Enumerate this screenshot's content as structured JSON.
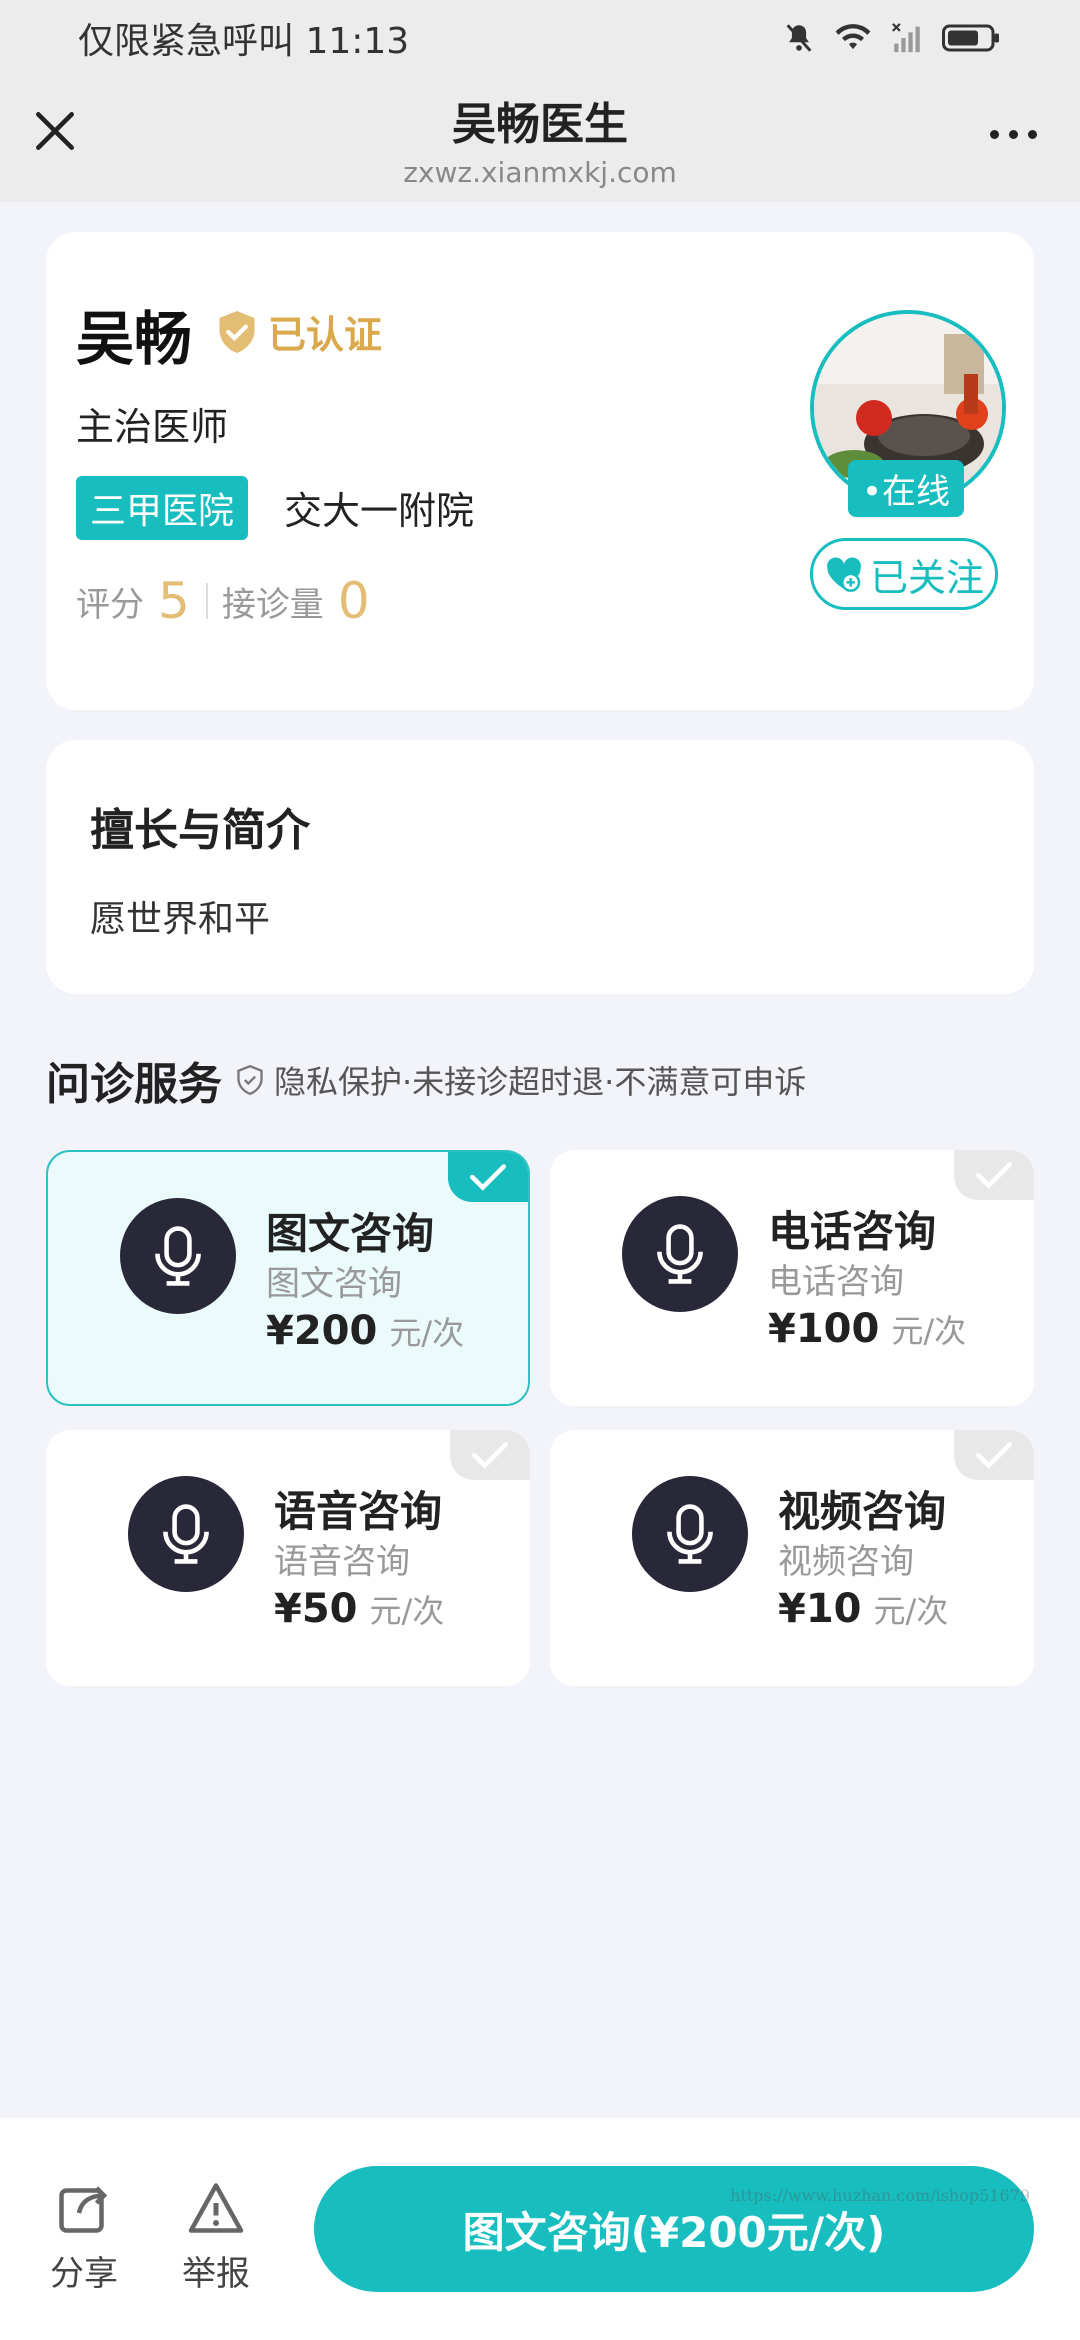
{
  "status_bar": {
    "left_text": "仅限紧急呼叫 11:13"
  },
  "header": {
    "title": "吴畅医生",
    "url": "zxwz.xianmxkj.com"
  },
  "doctor": {
    "name": "吴畅",
    "verified_label": "已认证",
    "title": "主治医师",
    "hospital_tag": "三甲医院",
    "hospital_name": "交大一附院",
    "rating_label": "评分",
    "rating_value": "5",
    "consult_label": "接诊量",
    "consult_value": "0",
    "online_label": "•在线",
    "follow_label": "已关注"
  },
  "intro": {
    "title": "擅长与简介",
    "text": "愿世界和平"
  },
  "services_header": {
    "title": "问诊服务",
    "subtitle": "隐私保护·未接诊超时退·不满意可申诉"
  },
  "services": [
    {
      "name": "图文咨询",
      "desc": "图文咨询",
      "price": "¥200",
      "unit": "元/次",
      "selected": true
    },
    {
      "name": "电话咨询",
      "desc": "电话咨询",
      "price": "¥100",
      "unit": "元/次",
      "selected": false
    },
    {
      "name": "语音咨询",
      "desc": "语音咨询",
      "price": "¥50",
      "unit": "元/次",
      "selected": false
    },
    {
      "name": "视频咨询",
      "desc": "视频咨询",
      "price": "¥10",
      "unit": "元/次",
      "selected": false
    }
  ],
  "bottom_bar": {
    "share_label": "分享",
    "report_label": "举报",
    "consult_button": "图文咨询(¥200元/次)"
  },
  "watermark": "https://www.huzhan.com/ishop51679",
  "colors": {
    "accent": "#17bdbf",
    "gold": "#d9a94c",
    "background": "#f2f4fa"
  }
}
